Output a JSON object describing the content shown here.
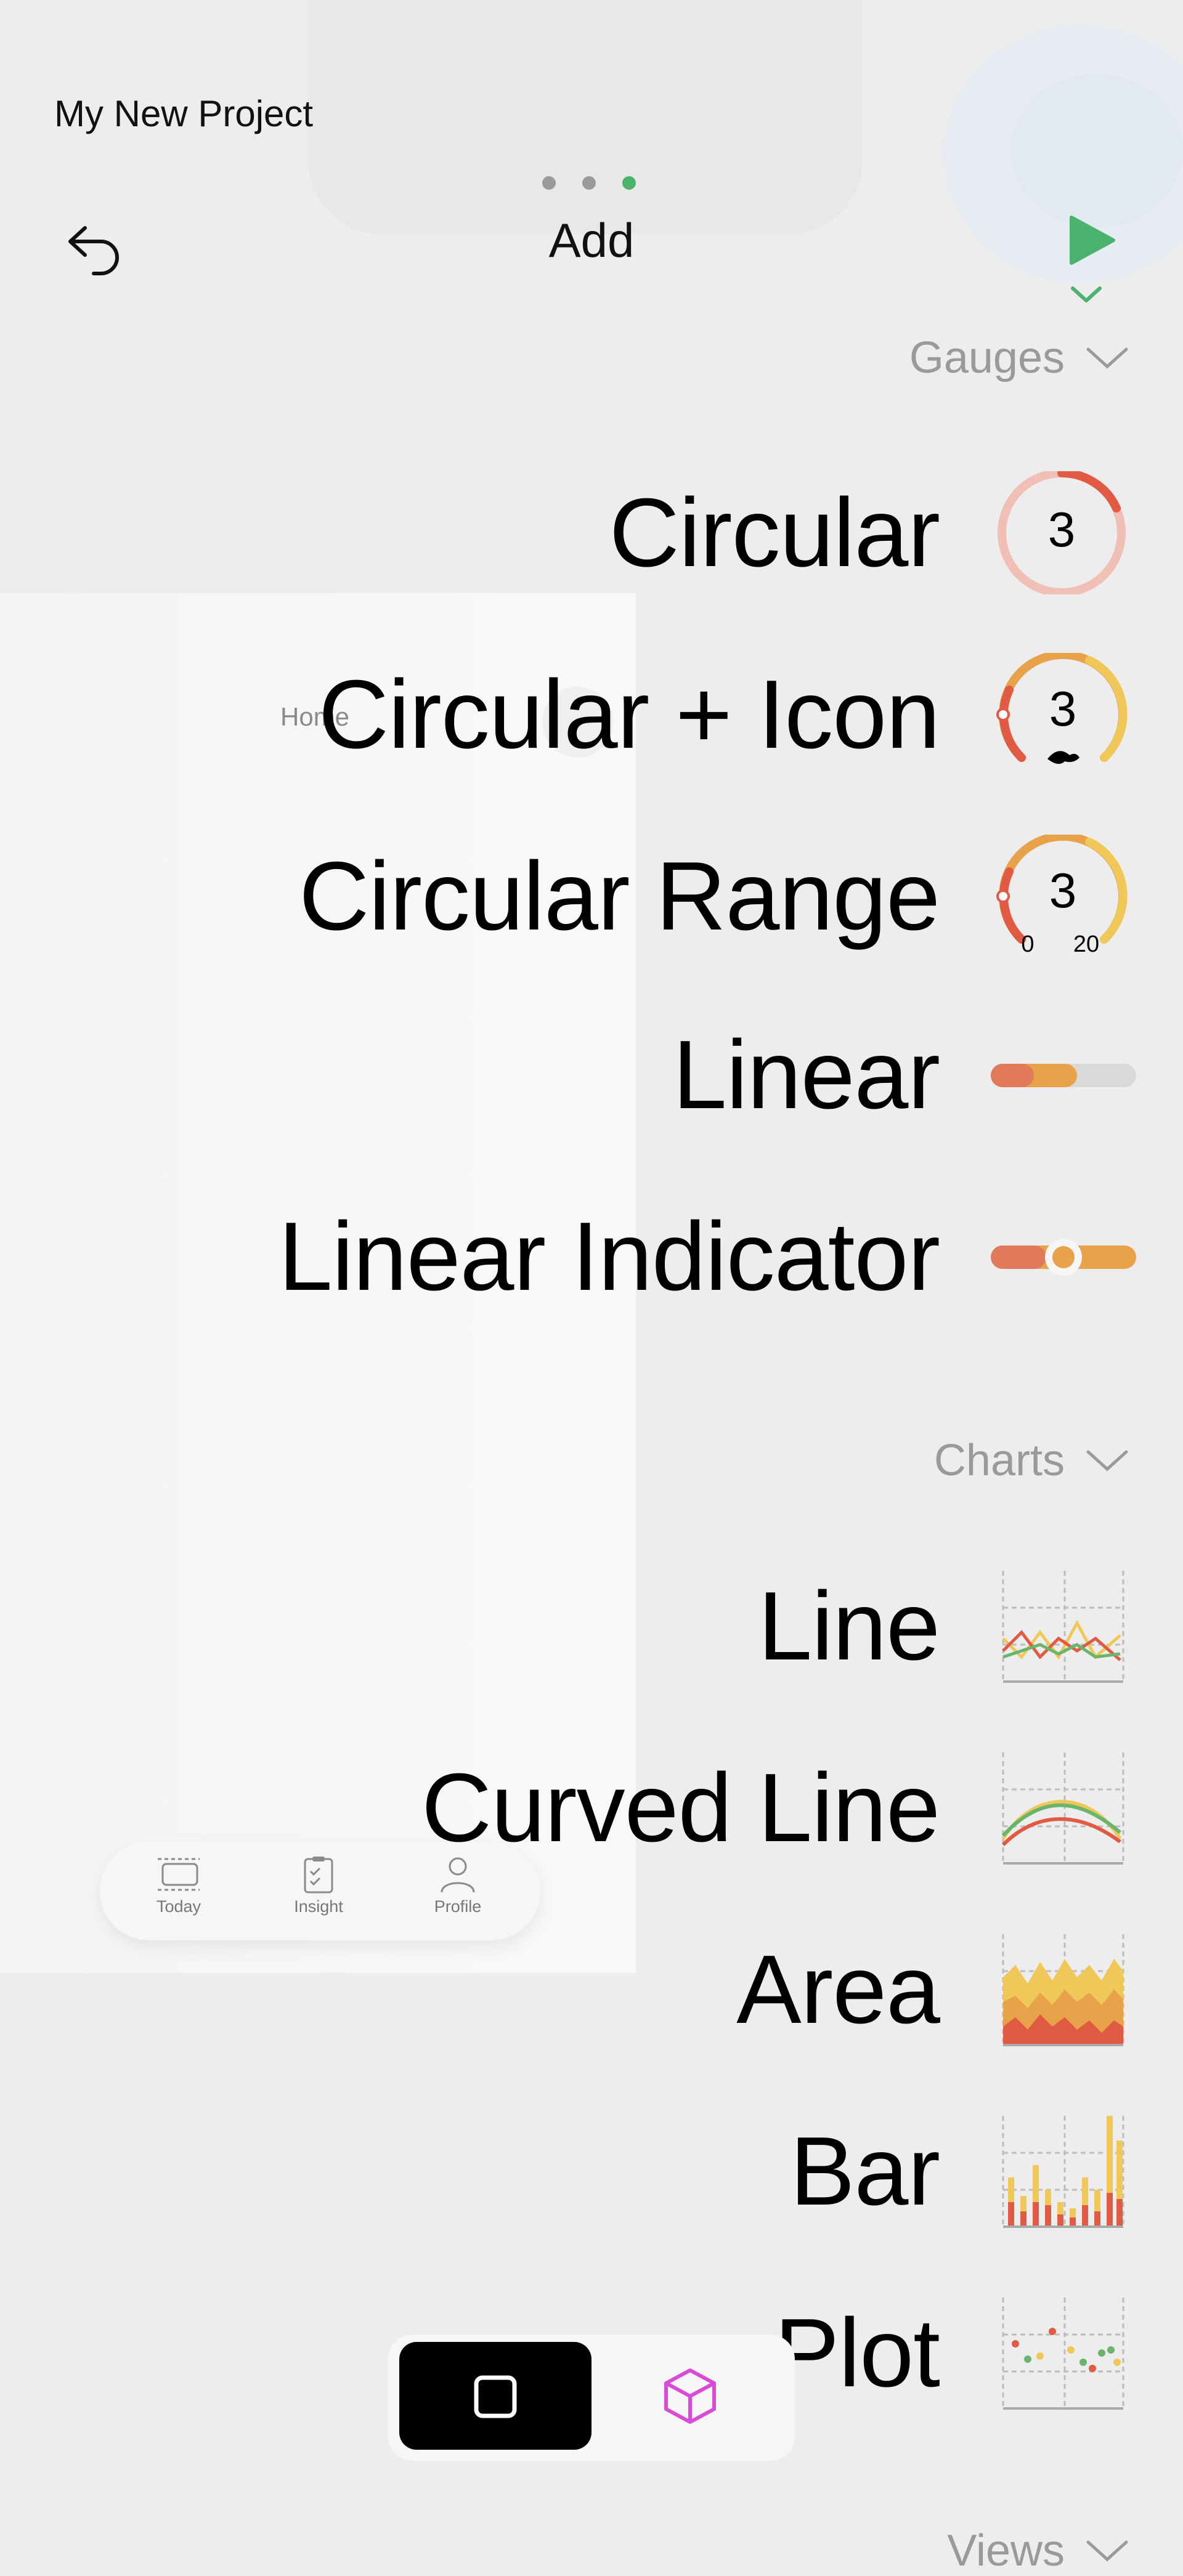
{
  "header": {
    "project_title": "My New Project",
    "screen_title": "Add",
    "page_dots": 3,
    "active_dot": 3
  },
  "preview": {
    "home_label": "Home",
    "tabs": [
      {
        "label": "Today",
        "icon": "list-icon"
      },
      {
        "label": "Insight",
        "icon": "clipboard-icon"
      },
      {
        "label": "Profile",
        "icon": "person-icon"
      }
    ]
  },
  "sections": {
    "gauges": {
      "title": "Gauges"
    },
    "charts": {
      "title": "Charts"
    },
    "views": {
      "title": "Views"
    }
  },
  "gauges": {
    "circular": {
      "label": "Circular",
      "value": "3"
    },
    "circular_icon": {
      "label": "Circular + Icon",
      "value": "3"
    },
    "circular_range": {
      "label": "Circular Range",
      "value": "3",
      "min": "0",
      "max": "20"
    },
    "linear": {
      "label": "Linear"
    },
    "linear_indicator": {
      "label": "Linear Indicator"
    }
  },
  "charts": {
    "line": {
      "label": "Line"
    },
    "curved_line": {
      "label": "Curved Line"
    },
    "area": {
      "label": "Area"
    },
    "bar": {
      "label": "Bar"
    },
    "plot": {
      "label": "Plot"
    }
  },
  "colors": {
    "accent_green": "#4cb36e",
    "gauge_red": "#e05a44",
    "gauge_orange": "#e8a24a",
    "gauge_yellow": "#f0c85a",
    "gauge_track": "#f0c0b6",
    "tool_3d_pink": "#d94ad6"
  }
}
